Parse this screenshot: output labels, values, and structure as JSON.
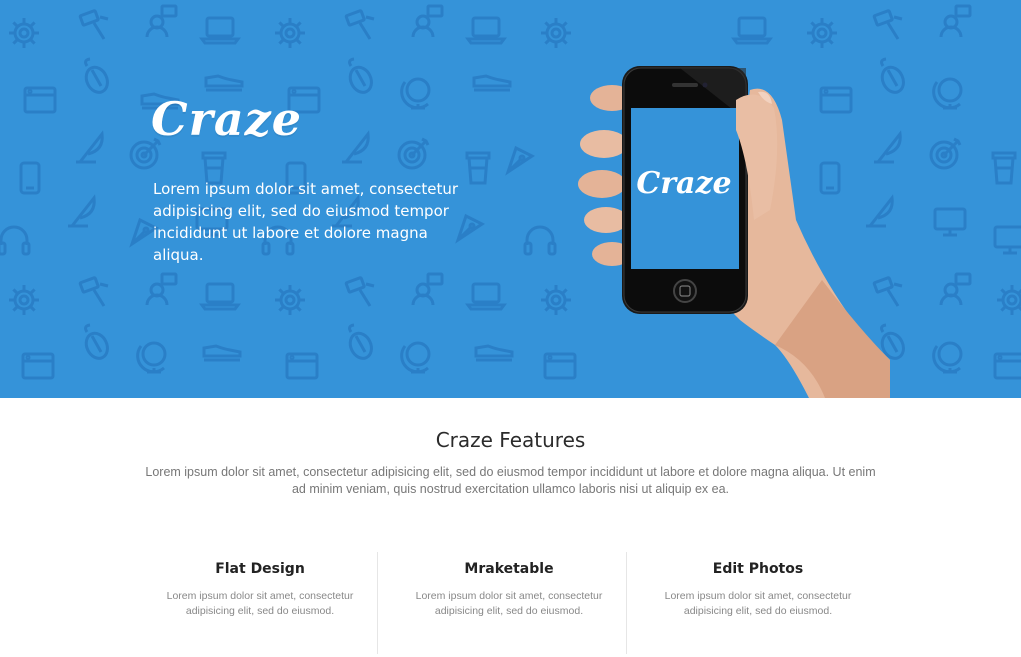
{
  "hero": {
    "brand": "Craze",
    "tagline": "Lorem ipsum dolor sit amet, consectetur adipisicing elit, sed do eiusmod tempor incididunt ut labore et dolore magna aliqua.",
    "phone_screen_brand": "Craze",
    "background_color": "#3593d9",
    "pattern_icons": [
      "gear-icon",
      "paintbrush-icon",
      "user-chat-icon",
      "laptop-icon",
      "browser-window-icon",
      "globe-icon",
      "target-icon",
      "phone-icon",
      "coffee-cup-icon",
      "headphones-icon",
      "quill-icon",
      "shoe-icon",
      "mouse-icon",
      "monitor-icon",
      "pen-icon"
    ]
  },
  "features": {
    "title": "Craze Features",
    "description": "Lorem ipsum dolor sit amet, consectetur adipisicing elit, sed do eiusmod tempor incididunt ut labore et dolore magna aliqua. Ut enim ad minim veniam, quis nostrud exercitation ullamco laboris nisi ut aliquip ex ea.",
    "items": [
      {
        "title": "Flat Design",
        "text": "Lorem ipsum dolor sit amet, consectetur adipisicing elit, sed do eiusmod."
      },
      {
        "title": "Mraketable",
        "text": "Lorem ipsum dolor sit amet, consectetur adipisicing elit, sed do eiusmod."
      },
      {
        "title": "Edit Photos",
        "text": "Lorem ipsum dolor sit amet, consectetur adipisicing elit, sed do eiusmod."
      }
    ]
  }
}
